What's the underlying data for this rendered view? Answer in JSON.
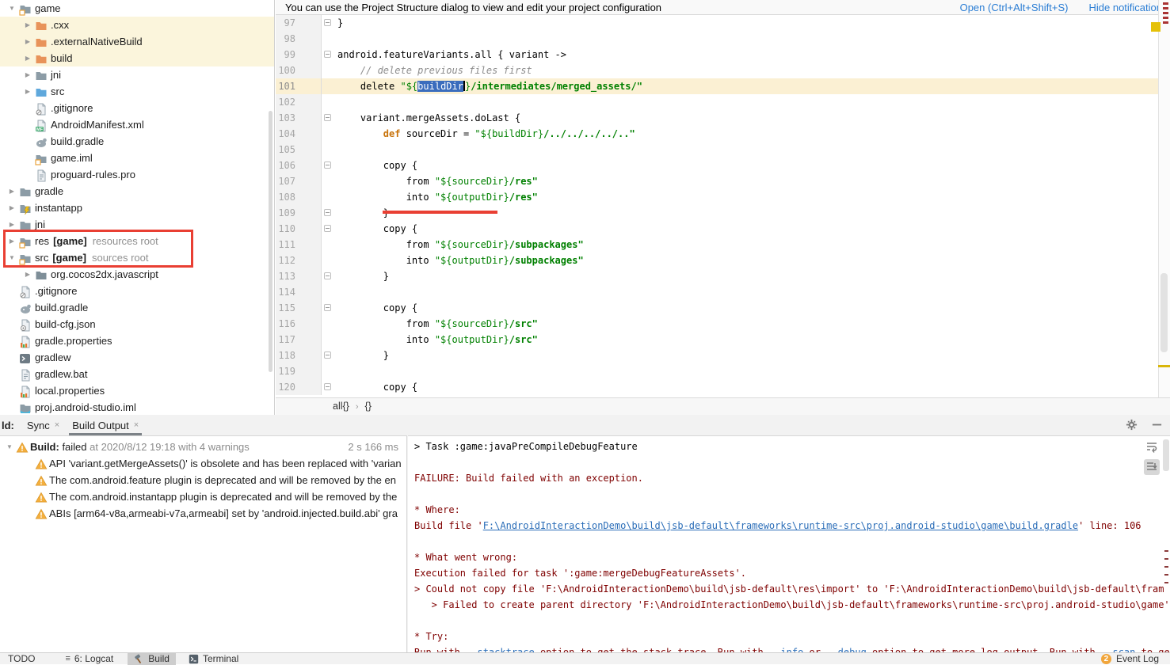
{
  "colors": {
    "selection_blue": "#3b6dbd",
    "string_green": "#008000",
    "keyword_orange": "#c8730b",
    "comment_gray": "#8c8c8c",
    "error_red_text": "#7f0000",
    "link_blue": "#2a7dd4",
    "annotation_red": "#e93f33",
    "warning_orange": "#f4af3d",
    "current_line": "#fbf0d3"
  },
  "notification": {
    "text": "You can use the Project Structure dialog to view and edit your project configuration",
    "open_label": "Open (Ctrl+Alt+Shift+S)",
    "hide_label": "Hide notification"
  },
  "project_tree": {
    "items": [
      {
        "label": "game",
        "icon": "folder-module",
        "level": 0,
        "arrow": "down"
      },
      {
        "label": ".cxx",
        "icon": "folder-excluded",
        "level": 1,
        "arrow": "right",
        "highlight": true
      },
      {
        "label": ".externalNativeBuild",
        "icon": "folder-excluded",
        "level": 1,
        "arrow": "right",
        "highlight": true
      },
      {
        "label": "build",
        "icon": "folder-excluded",
        "level": 1,
        "arrow": "right",
        "highlight": true
      },
      {
        "label": "jni",
        "icon": "folder",
        "level": 1,
        "arrow": "right"
      },
      {
        "label": "src",
        "icon": "folder-source",
        "level": 1,
        "arrow": "right"
      },
      {
        "label": ".gitignore",
        "icon": "file-ignore",
        "level": 1
      },
      {
        "label": "AndroidManifest.xml",
        "icon": "file-manifest",
        "level": 1
      },
      {
        "label": "build.gradle",
        "icon": "file-gradle",
        "level": 1
      },
      {
        "label": "game.iml",
        "icon": "folder-module",
        "level": 1
      },
      {
        "label": "proguard-rules.pro",
        "icon": "file-text",
        "level": 1
      },
      {
        "label": "gradle",
        "icon": "folder",
        "level": 0,
        "arrow": "right"
      },
      {
        "label": "instantapp",
        "icon": "folder-instant",
        "level": 0,
        "arrow": "right"
      },
      {
        "label": "jni",
        "icon": "folder",
        "level": 0,
        "arrow": "right"
      },
      {
        "label": "res",
        "label_bold": "[game]",
        "note": "resources root",
        "icon": "folder-module",
        "level": 0,
        "arrow": "right"
      },
      {
        "label": "src",
        "label_bold": "[game]",
        "note": "sources root",
        "icon": "folder-module",
        "level": 0,
        "arrow": "down"
      },
      {
        "label": "org.cocos2dx.javascript",
        "icon": "folder-package",
        "level": 1,
        "arrow": "right"
      },
      {
        "label": ".gitignore",
        "icon": "file-ignore",
        "level": 0
      },
      {
        "label": "build.gradle",
        "icon": "file-gradle",
        "level": 0
      },
      {
        "label": "build-cfg.json",
        "icon": "file-json",
        "level": 0
      },
      {
        "label": "gradle.properties",
        "icon": "file-properties",
        "level": 0
      },
      {
        "label": "gradlew",
        "icon": "file-console",
        "level": 0
      },
      {
        "label": "gradlew.bat",
        "icon": "file-text",
        "level": 0
      },
      {
        "label": "local.properties",
        "icon": "file-properties",
        "level": 0
      },
      {
        "label": "proj.android-studio.iml",
        "icon": "file-iml2",
        "level": 0
      }
    ]
  },
  "editor": {
    "breadcrumbs": [
      "all{}",
      "{}"
    ],
    "breadcrumb_sep": "›",
    "lines": [
      {
        "n": 97,
        "f": 1,
        "seg": [
          [
            "p",
            "}"
          ]
        ]
      },
      {
        "n": 98,
        "seg": []
      },
      {
        "n": 99,
        "f": 1,
        "seg": [
          [
            "p",
            "android.featureVariants.all { variant ->"
          ]
        ]
      },
      {
        "n": 100,
        "seg": [
          [
            "c",
            "    // delete previous files first"
          ]
        ]
      },
      {
        "n": 101,
        "cur": 1,
        "seg": [
          [
            "p",
            "    delete "
          ],
          [
            "v",
            "\"${"
          ],
          [
            "sel",
            "buildDir"
          ],
          [
            "caret",
            ""
          ],
          [
            "v",
            "}"
          ],
          [
            "s",
            "/intermediates/merged_assets/\""
          ]
        ]
      },
      {
        "n": 102,
        "seg": []
      },
      {
        "n": 103,
        "f": 1,
        "seg": [
          [
            "p",
            "    variant.mergeAssets.doLast {"
          ]
        ]
      },
      {
        "n": 104,
        "seg": [
          [
            "p",
            "        "
          ],
          [
            "k",
            "def"
          ],
          [
            "p",
            " sourceDir = "
          ],
          [
            "v",
            "\"${buildDir}"
          ],
          [
            "s",
            "/../../../../..\""
          ]
        ]
      },
      {
        "n": 105,
        "seg": []
      },
      {
        "n": 106,
        "f": 1,
        "seg": [
          [
            "p",
            "        copy {"
          ]
        ]
      },
      {
        "n": 107,
        "seg": [
          [
            "p",
            "            from "
          ],
          [
            "v",
            "\"${sourceDir}"
          ],
          [
            "s",
            "/res\""
          ]
        ]
      },
      {
        "n": 108,
        "seg": [
          [
            "p",
            "            into "
          ],
          [
            "v",
            "\"${outputDir}"
          ],
          [
            "s",
            "/res\""
          ]
        ]
      },
      {
        "n": 109,
        "f": 1,
        "seg": [
          [
            "p",
            "        }"
          ]
        ]
      },
      {
        "n": 110,
        "f": 1,
        "seg": [
          [
            "p",
            "        copy {"
          ]
        ]
      },
      {
        "n": 111,
        "seg": [
          [
            "p",
            "            from "
          ],
          [
            "v",
            "\"${sourceDir}"
          ],
          [
            "s",
            "/subpackages\""
          ]
        ]
      },
      {
        "n": 112,
        "seg": [
          [
            "p",
            "            into "
          ],
          [
            "v",
            "\"${outputDir}"
          ],
          [
            "s",
            "/subpackages\""
          ]
        ]
      },
      {
        "n": 113,
        "f": 1,
        "seg": [
          [
            "p",
            "        }"
          ]
        ]
      },
      {
        "n": 114,
        "seg": []
      },
      {
        "n": 115,
        "f": 1,
        "seg": [
          [
            "p",
            "        copy {"
          ]
        ]
      },
      {
        "n": 116,
        "seg": [
          [
            "p",
            "            from "
          ],
          [
            "v",
            "\"${sourceDir}"
          ],
          [
            "s",
            "/src\""
          ]
        ]
      },
      {
        "n": 117,
        "seg": [
          [
            "p",
            "            into "
          ],
          [
            "v",
            "\"${outputDir}"
          ],
          [
            "s",
            "/src\""
          ]
        ]
      },
      {
        "n": 118,
        "f": 1,
        "seg": [
          [
            "p",
            "        }"
          ]
        ]
      },
      {
        "n": 119,
        "seg": []
      },
      {
        "n": 120,
        "f": 1,
        "seg": [
          [
            "p",
            "        copy {"
          ]
        ]
      }
    ]
  },
  "build_panel": {
    "win_label": "ld:",
    "tabs": [
      {
        "label": "Sync",
        "active": false
      },
      {
        "label": "Build Output",
        "active": true
      }
    ],
    "close_glyph": "×",
    "tree": {
      "title_bold": "Build:",
      "title_plain": " failed",
      "title_gray": " at 2020/8/12 19:18 with 4 warnings",
      "duration": "2 s 166 ms",
      "warnings": [
        "API 'variant.getMergeAssets()' is obsolete and has been replaced with 'varian",
        "The com.android.feature plugin is deprecated and will be removed by the en",
        "The com.android.instantapp plugin is deprecated and will be removed by the",
        "ABIs [arm64-v8a,armeabi-v7a,armeabi] set by 'android.injected.build.abi' gra"
      ]
    },
    "console": {
      "lines": [
        {
          "seg": [
            [
              "t",
              "> Task :game:javaPreCompileDebugFeature"
            ]
          ]
        },
        {
          "seg": []
        },
        {
          "seg": [
            [
              "e",
              "FAILURE: Build failed with an exception."
            ]
          ]
        },
        {
          "seg": []
        },
        {
          "seg": [
            [
              "e",
              "* Where:"
            ]
          ]
        },
        {
          "seg": [
            [
              "e",
              "Build file '"
            ],
            [
              "l",
              "F:\\AndroidInteractionDemo\\build\\jsb-default\\frameworks\\runtime-src\\proj.android-studio\\game\\build.gradle"
            ],
            [
              "e",
              "' line: 106"
            ]
          ]
        },
        {
          "seg": []
        },
        {
          "seg": [
            [
              "e",
              "* What went wrong:"
            ]
          ]
        },
        {
          "seg": [
            [
              "e",
              "Execution failed for task ':game:mergeDebugFeatureAssets'."
            ]
          ]
        },
        {
          "seg": [
            [
              "e",
              "> Could not copy file 'F:\\AndroidInteractionDemo\\build\\jsb-default\\res\\import' to 'F:\\AndroidInteractionDemo\\build\\jsb-default\\fram"
            ]
          ]
        },
        {
          "seg": [
            [
              "e",
              "   > Failed to create parent directory 'F:\\AndroidInteractionDemo\\build\\jsb-default\\frameworks\\runtime-src\\proj.android-studio\\game'"
            ]
          ]
        },
        {
          "seg": []
        },
        {
          "seg": [
            [
              "e",
              "* Try:"
            ]
          ]
        },
        {
          "seg": [
            [
              "e",
              "Run with "
            ],
            [
              "l",
              "--stacktrace"
            ],
            [
              "e",
              " option to get the stack trace. Run with "
            ],
            [
              "l",
              "--info"
            ],
            [
              "e",
              " or "
            ],
            [
              "l",
              "--debug"
            ],
            [
              "e",
              " option to get more log output. Run with "
            ],
            [
              "l",
              "--scan"
            ],
            [
              "e",
              " to ge"
            ]
          ]
        }
      ]
    }
  },
  "status_bar": {
    "todo_label": "TODO",
    "logcat_glyph": "≡",
    "logcat_label": "6: Logcat",
    "build_label": "Build",
    "terminal_label": "Terminal",
    "event_count": "2",
    "event_log_label": "Event Log"
  }
}
